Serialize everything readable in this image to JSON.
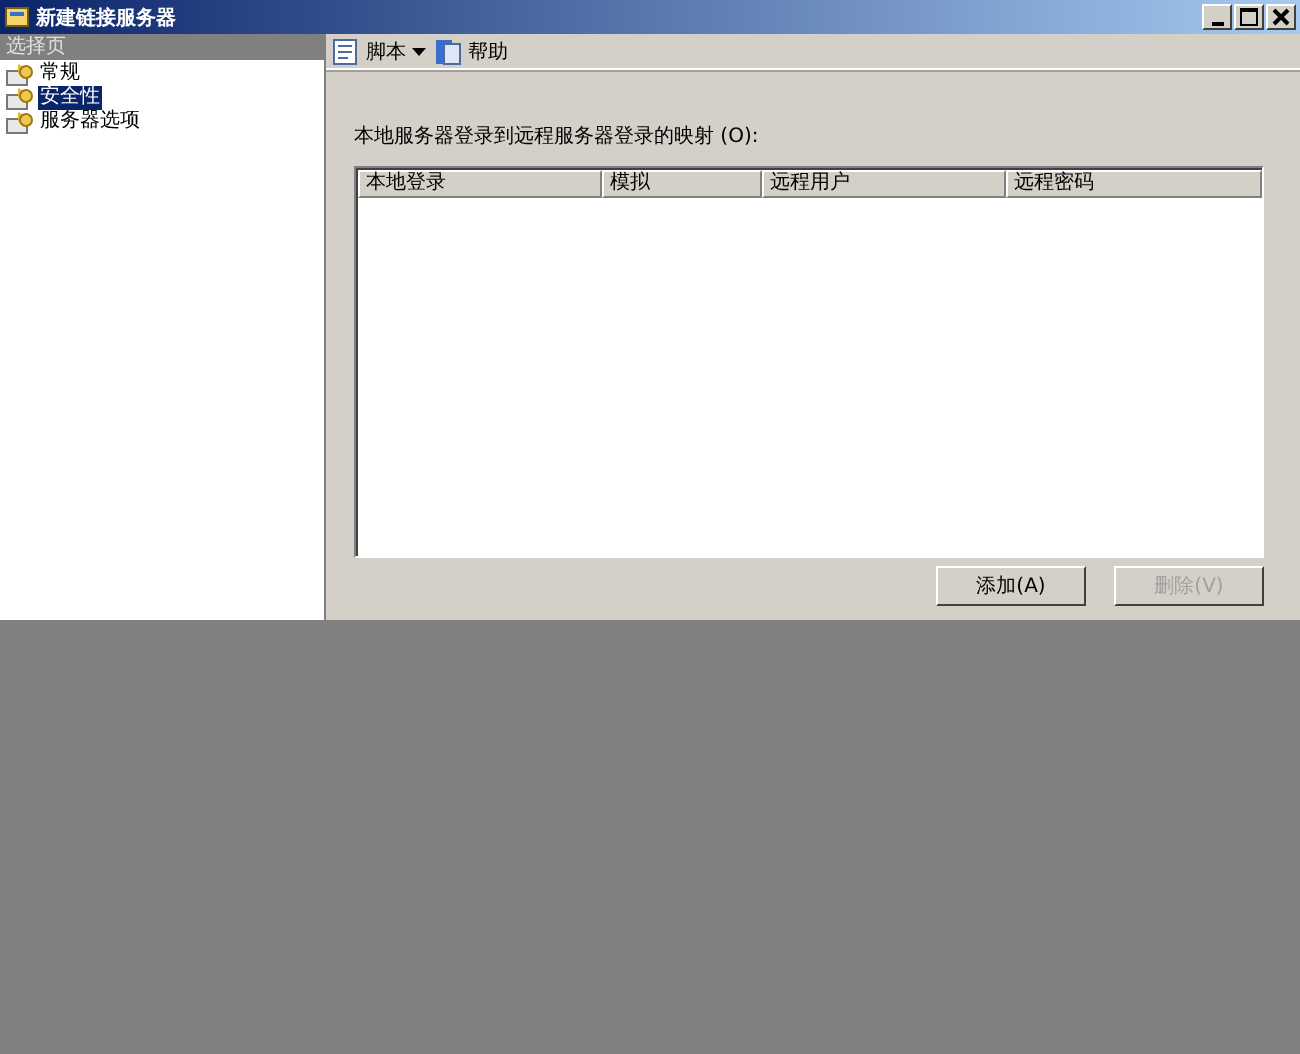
{
  "window": {
    "title": "新建链接服务器"
  },
  "sidebar": {
    "header": "选择页",
    "items": [
      {
        "label": "常规",
        "selected": false
      },
      {
        "label": "安全性",
        "selected": true
      },
      {
        "label": "服务器选项",
        "selected": false
      }
    ]
  },
  "toolbar": {
    "items": [
      {
        "label": "脚本",
        "kind": "dropdown"
      },
      {
        "label": "帮助",
        "kind": "button"
      }
    ]
  },
  "mapping_label": "本地服务器登录到远程服务器登录的映射 (O):",
  "table": {
    "columns": [
      "本地登录",
      "模拟",
      "远程用户",
      "远程密码"
    ]
  },
  "buttons": [
    {
      "label": "添加(A)",
      "disabled": false
    },
    {
      "label": "删除(V)",
      "disabled": true
    }
  ]
}
